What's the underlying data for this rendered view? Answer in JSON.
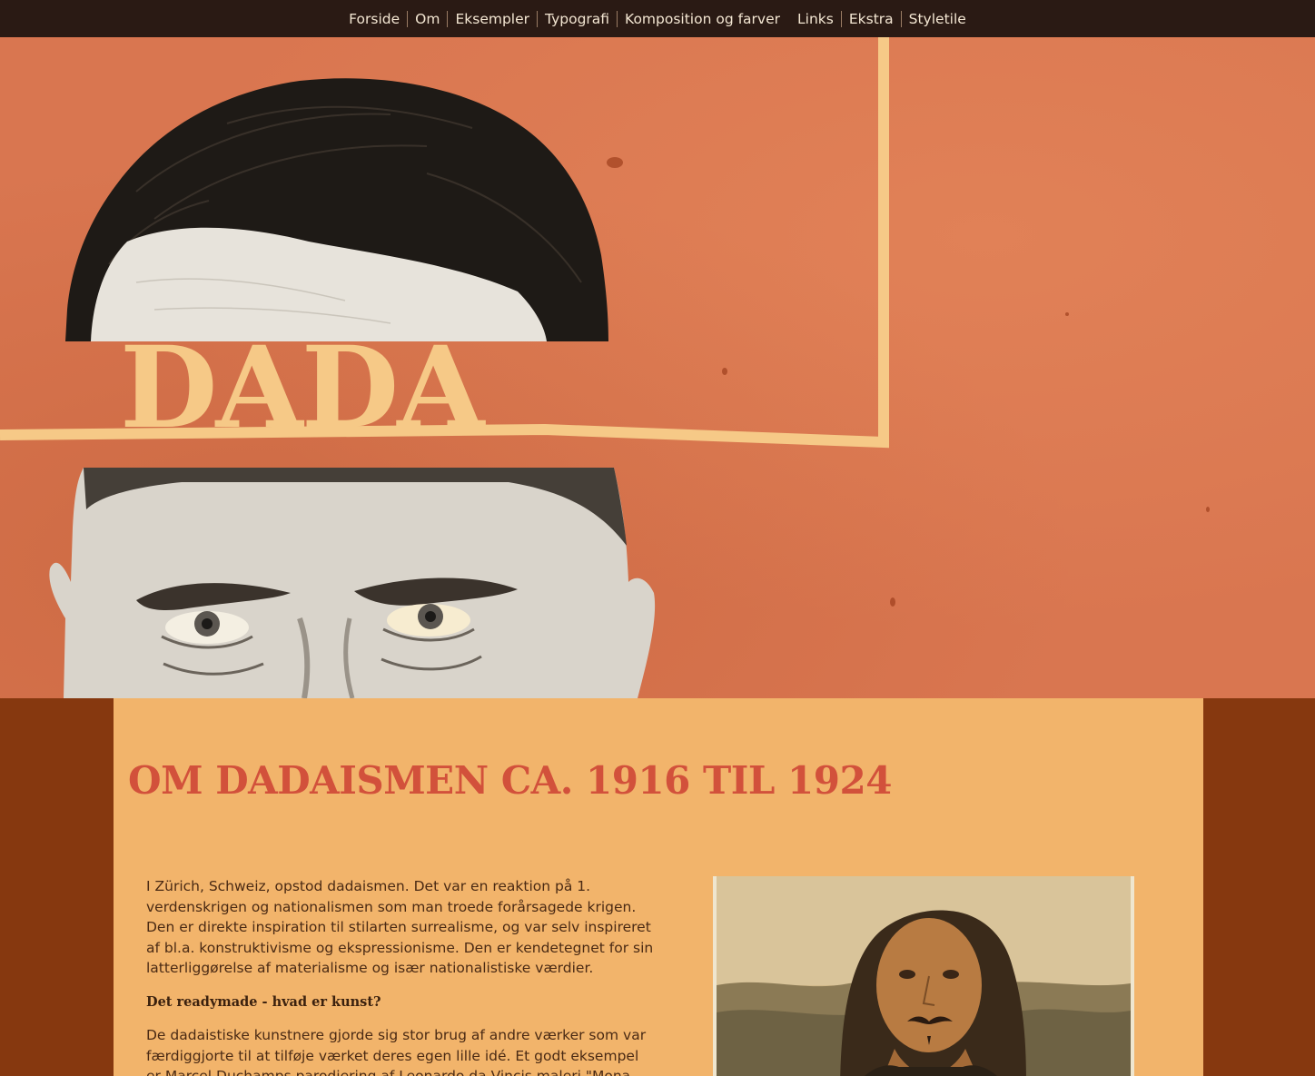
{
  "nav": {
    "items": [
      {
        "label": "Forside"
      },
      {
        "label": "Om"
      },
      {
        "label": "Eksempler"
      },
      {
        "label": "Typografi"
      },
      {
        "label": "Komposition og farver"
      },
      {
        "label": "Links"
      },
      {
        "label": "Ekstra"
      },
      {
        "label": "Styletile"
      }
    ]
  },
  "hero": {
    "title": "DADA"
  },
  "main": {
    "heading": "OM DADAISMEN CA. 1916 TIL 1924",
    "intro": "I Zürich, Schweiz, opstod dadaismen. Det var en reaktion på 1. verdenskrigen og nationalismen som man troede forårsagede krigen. Den er direkte inspiration til stilarten surrealisme, og var selv inspireret af bl.a. konstruktivisme og ekspressionisme. Den er kendetegnet for sin latterliggørelse af materialisme og især nationalistiske værdier.",
    "subheading": "Det readymade - hvad er kunst?",
    "paragraph2": "De dadaistiske kunstnere gjorde sig stor brug af andre værker som var færdiggjorte til at tilføje værket deres egen lille idé. Et godt eksempel er Marcel Duchamps parodiering af Leonardo da Vincis maleri \"Mona Lisa\"."
  },
  "colors": {
    "nav_bg": "#2a1a14",
    "hero_bg": "#d97650",
    "accent_yellow": "#f6c987",
    "content_bg": "#f2b46b",
    "page_bg": "#86380f",
    "heading": "#d2513b"
  }
}
